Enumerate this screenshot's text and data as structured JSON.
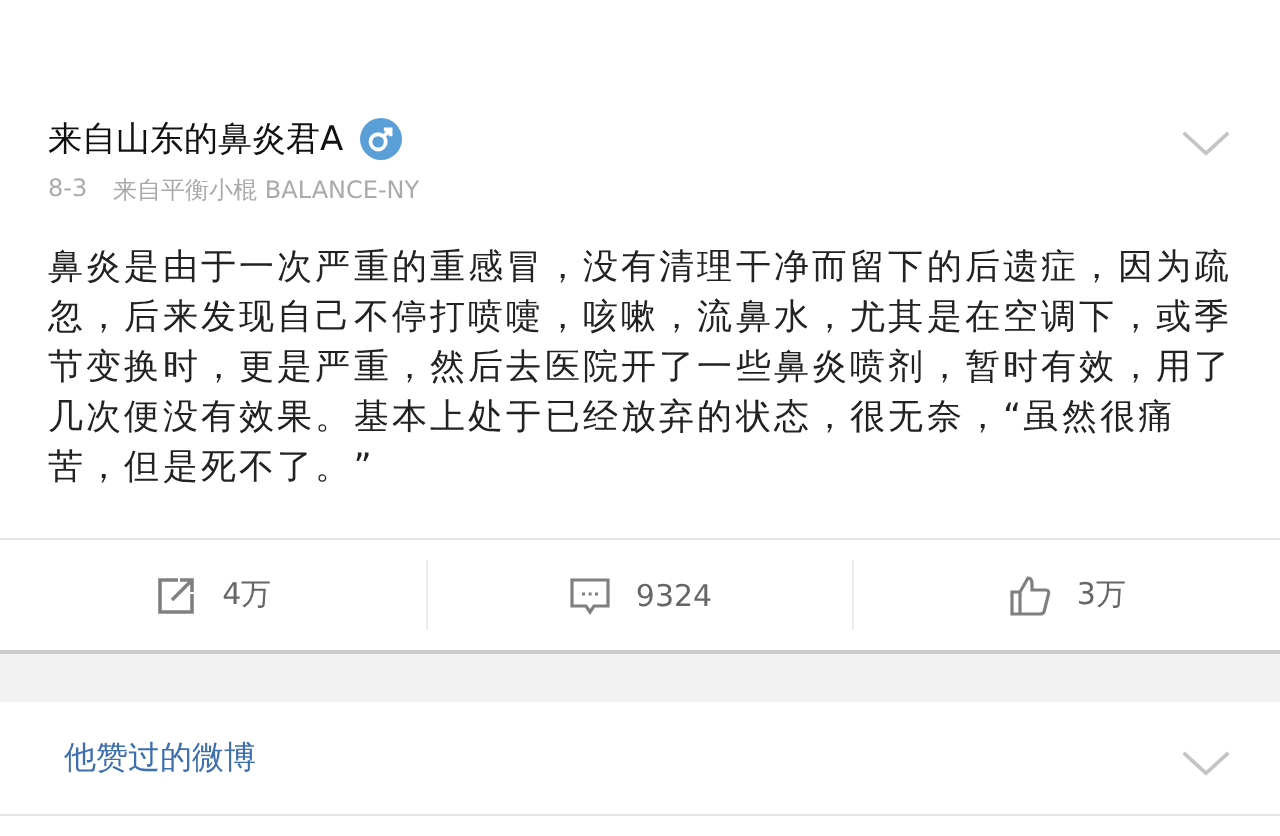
{
  "post": {
    "author": "来自山东的鼻炎君A",
    "date": "8-3",
    "source": "来自平衡小棍 BALANCE-NY",
    "body": "鼻炎是由于一次严重的重感冒，没有清理干净而留下的后遗症，因为疏忽，后来发现自己不停打喷嚏，咳嗽，流鼻水，尤其是在空调下，或季节变换时，更是严重，然后去医院开了一些鼻炎喷剂，暂时有效，用了几次便没有效果。基本上处于已经放弃的状态，很无奈，“虽然很痛苦，但是死不了。”",
    "actions": [
      {
        "kind": "repost",
        "count": "4万"
      },
      {
        "kind": "comment",
        "count": "9324"
      },
      {
        "kind": "like",
        "count": "3万"
      }
    ]
  },
  "liked_section": {
    "title": "他赞过的微博"
  }
}
